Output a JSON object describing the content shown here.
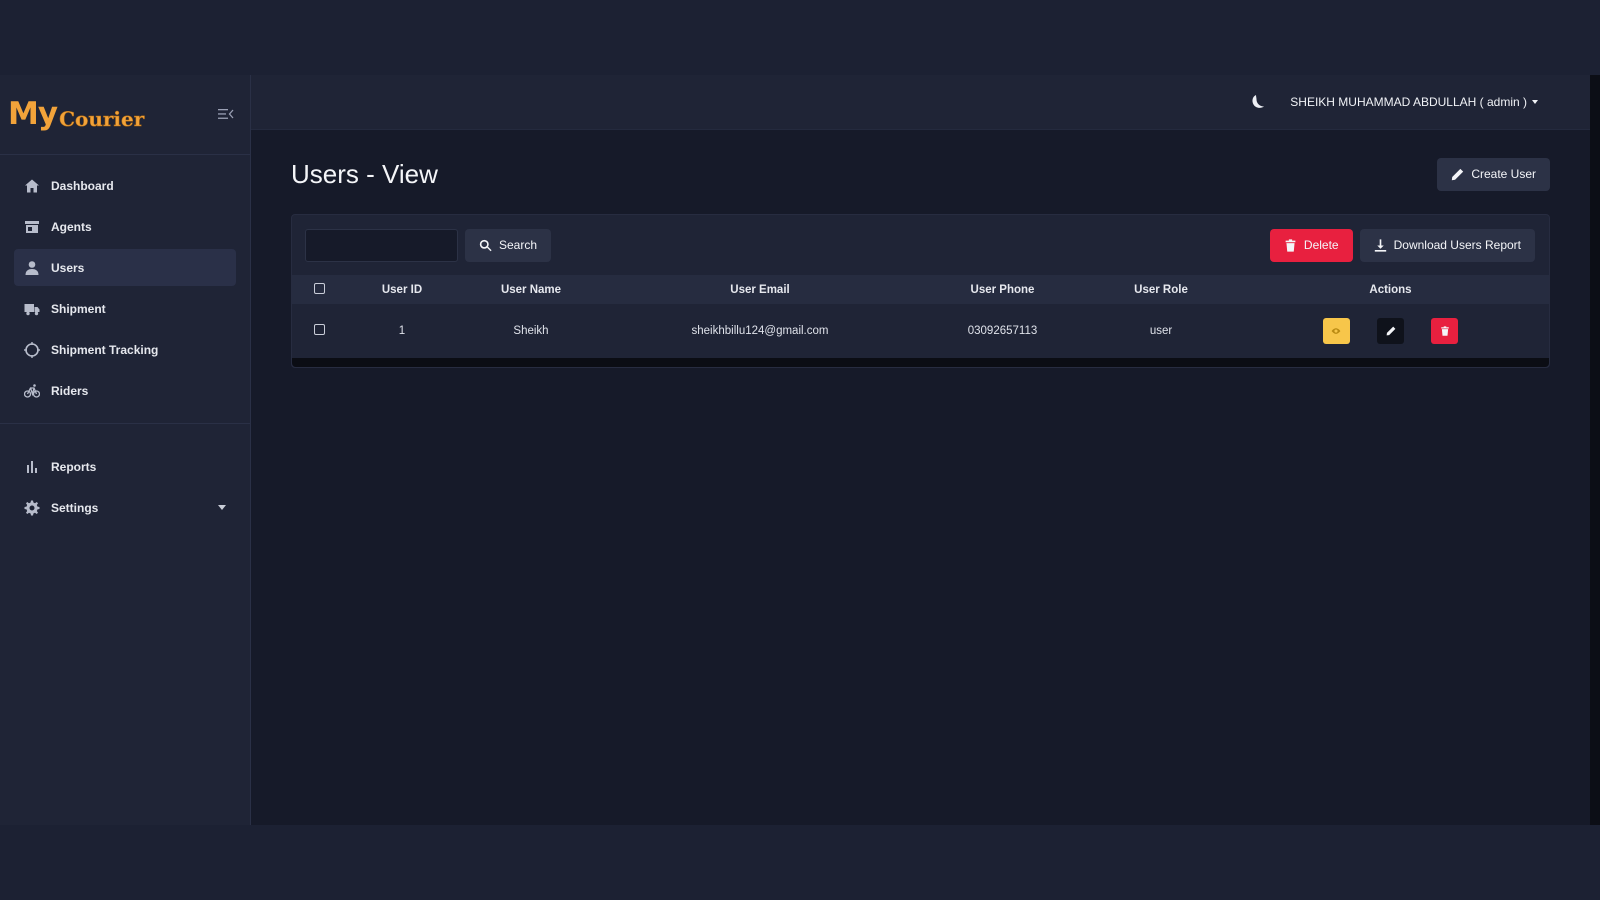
{
  "brand": {
    "logo_my": "My",
    "logo_courier": "Courier"
  },
  "sidebar": {
    "items": [
      {
        "label": "Dashboard",
        "icon": "home-icon"
      },
      {
        "label": "Agents",
        "icon": "store-icon"
      },
      {
        "label": "Users",
        "icon": "user-icon",
        "active": true
      },
      {
        "label": "Shipment",
        "icon": "truck-icon"
      },
      {
        "label": "Shipment Tracking",
        "icon": "target-icon"
      },
      {
        "label": "Riders",
        "icon": "bicycle-icon"
      }
    ],
    "items2": [
      {
        "label": "Reports",
        "icon": "bar-chart-icon"
      },
      {
        "label": "Settings",
        "icon": "gear-icon",
        "has_submenu": true
      }
    ]
  },
  "topbar": {
    "user_label": "SHEIKH MUHAMMAD ABDULLAH ( admin )"
  },
  "page": {
    "title": "Users - View",
    "create_button": "Create User"
  },
  "toolbar": {
    "search_value": "",
    "search_button": "Search",
    "delete_button": "Delete",
    "download_button": "Download Users Report"
  },
  "table": {
    "columns": [
      "User ID",
      "User Name",
      "User Email",
      "User Phone",
      "User Role",
      "Actions"
    ],
    "rows": [
      {
        "id": "1",
        "name": "Sheikh",
        "email": "sheikhbillu124@gmail.com",
        "phone": "03092657113",
        "role": "user"
      }
    ]
  },
  "colors": {
    "accent": "#f2a33a",
    "danger": "#e8203f",
    "warning": "#f7c64a",
    "background": "#161a29",
    "panel": "#1f2436"
  }
}
